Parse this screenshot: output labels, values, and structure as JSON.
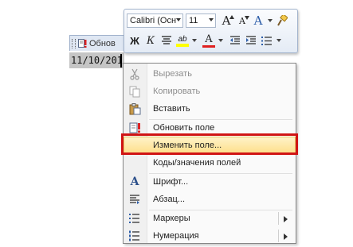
{
  "mini_toolbar": {
    "font_name": "Calibri (Осн",
    "font_size": "11",
    "grow_font": "A",
    "shrink_font": "A",
    "styles": "A",
    "bold": "Ж",
    "italic": "К",
    "highlight": "ab",
    "font_color": "A"
  },
  "field_tab": {
    "label": "Обнов"
  },
  "field_value": "11/10/201",
  "context_menu": {
    "items": [
      {
        "label": "Вырезать",
        "icon": "scissors-icon",
        "disabled": true
      },
      {
        "label": "Копировать",
        "icon": "copy-icon",
        "disabled": true
      },
      {
        "label": "Вставить",
        "icon": "paste-icon",
        "disabled": false
      },
      {
        "label": "Обновить поле",
        "icon": "update-field-icon",
        "disabled": false
      },
      {
        "label": "Изменить поле...",
        "icon": "",
        "disabled": false,
        "highlighted": true
      },
      {
        "label": "Коды/значения полей",
        "icon": "",
        "disabled": false
      },
      {
        "label": "Шрифт...",
        "icon": "font-icon",
        "disabled": false
      },
      {
        "label": "Абзац...",
        "icon": "paragraph-icon",
        "disabled": false
      },
      {
        "label": "Маркеры",
        "icon": "bullets-icon",
        "disabled": false,
        "submenu": true
      },
      {
        "label": "Нумерация",
        "icon": "numbering-icon",
        "disabled": false,
        "submenu": true
      }
    ]
  },
  "colors": {
    "highlight_red": "#d01414",
    "menu_hover": "#fddf8a",
    "highlighter_yellow": "#ffff00",
    "font_red": "#e02020"
  }
}
